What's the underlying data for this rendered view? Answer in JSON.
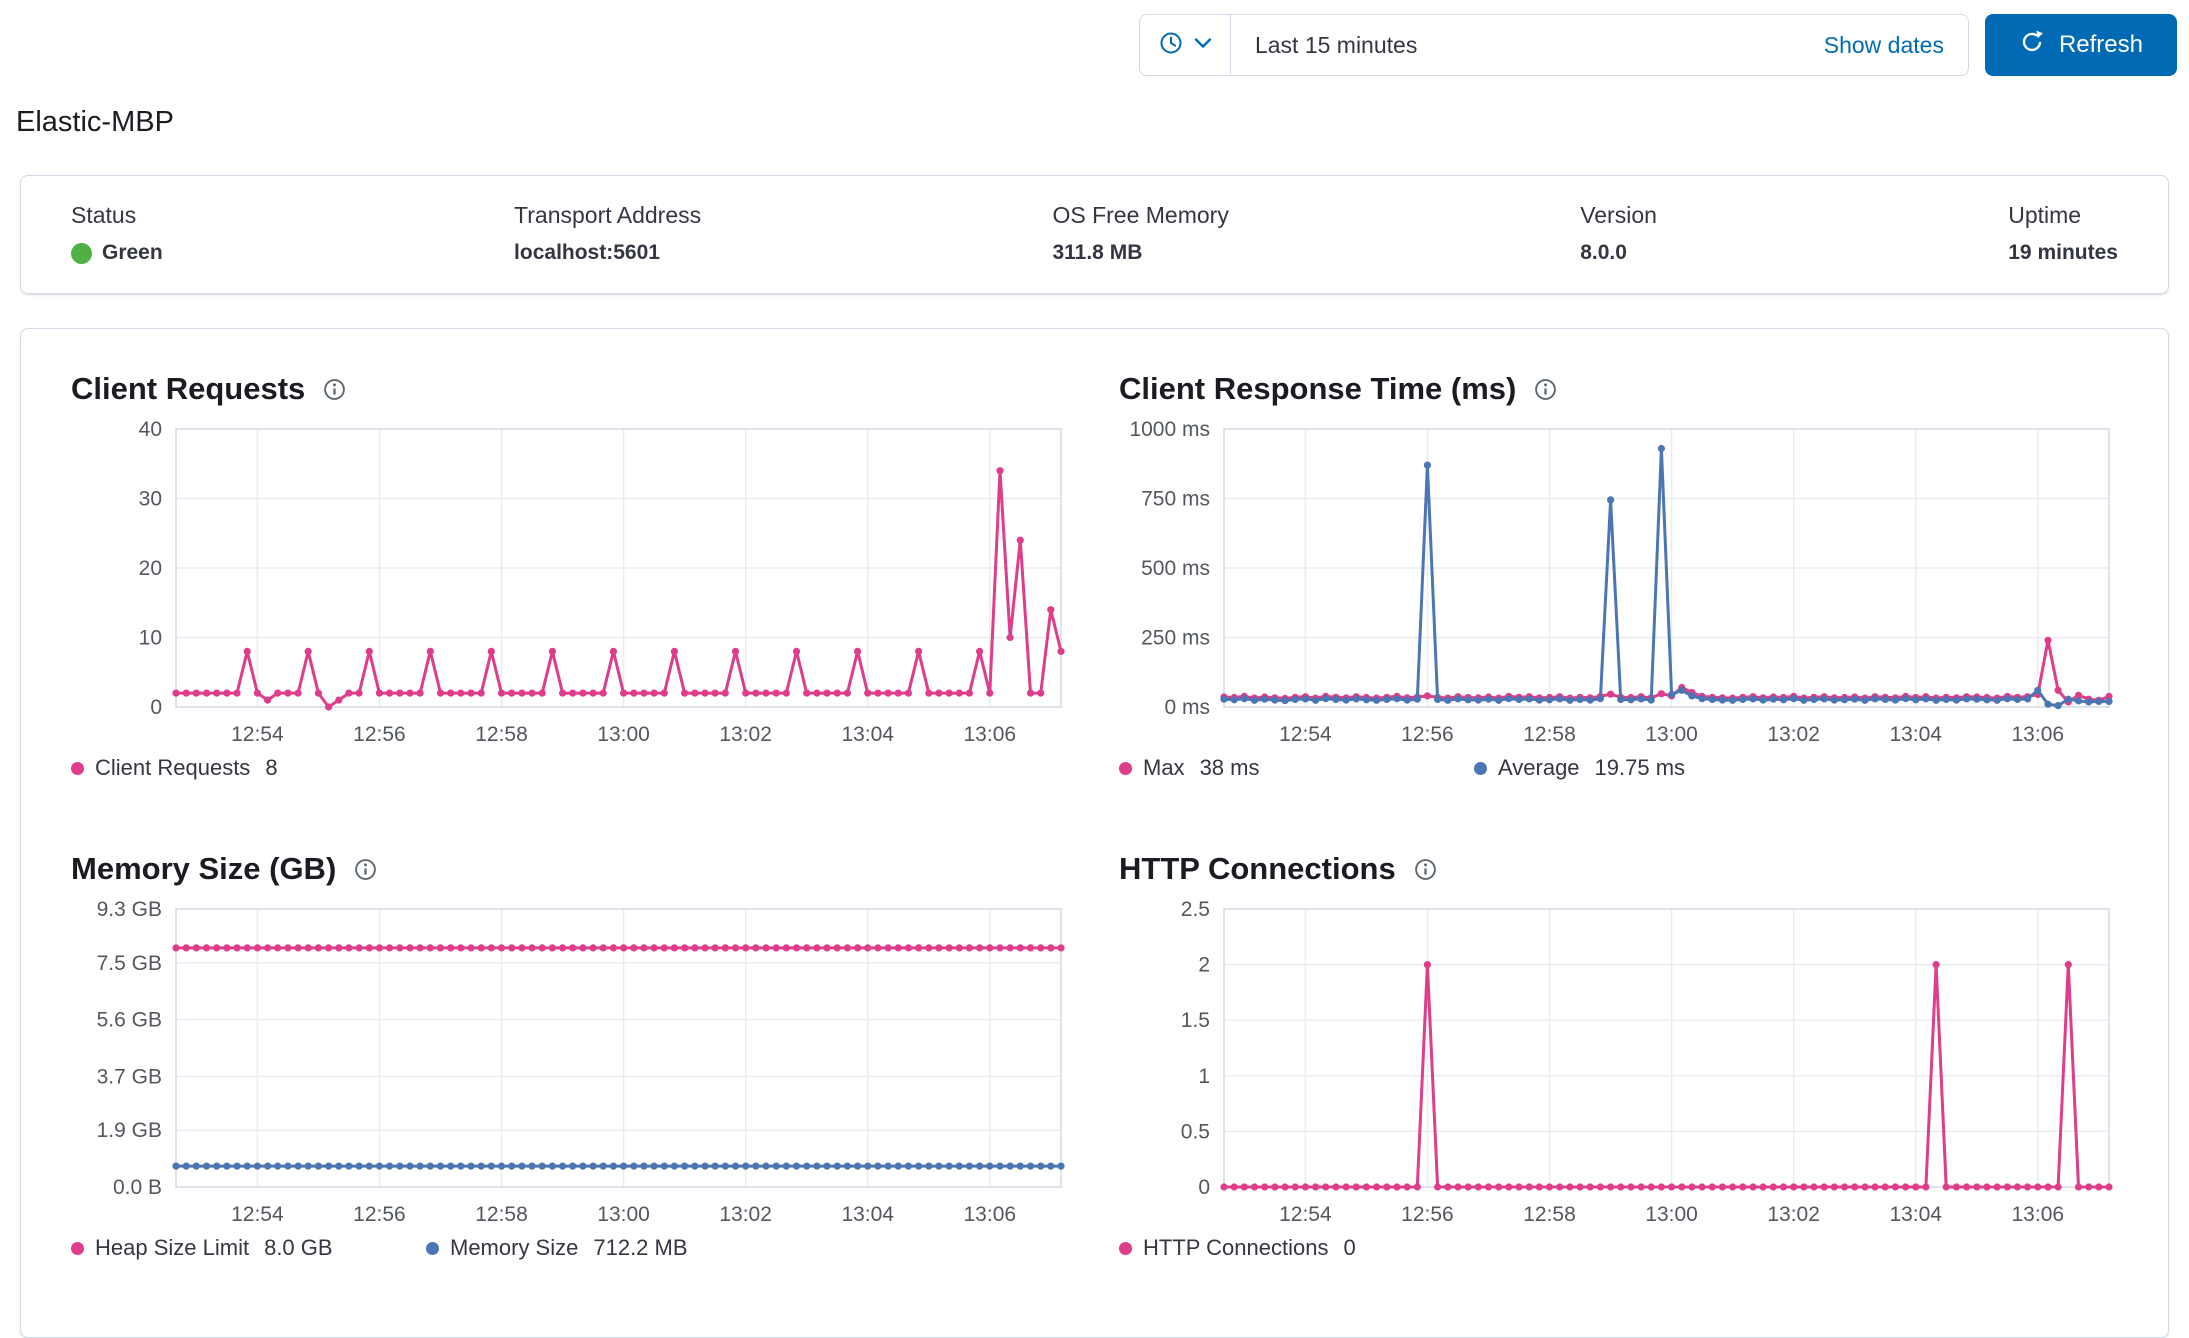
{
  "page": {
    "title": "Elastic-MBP"
  },
  "timepicker": {
    "quick_label": "Last 15 minutes",
    "show_dates": "Show dates",
    "refresh": "Refresh"
  },
  "colors": {
    "primary_blue": "#006bb4",
    "series_pink": "#dd3d8a",
    "series_blue": "#4c76b3",
    "status_green": "#4fb043",
    "grid_line": "#e9edf3",
    "plot_border": "#d3dae6"
  },
  "status_bar": {
    "items": [
      {
        "label": "Status",
        "value": "Green"
      },
      {
        "label": "Transport Address",
        "value": "localhost:5601"
      },
      {
        "label": "OS Free Memory",
        "value": "311.8 MB"
      },
      {
        "label": "Version",
        "value": "8.0.0"
      },
      {
        "label": "Uptime",
        "value": "19 minutes"
      }
    ]
  },
  "chart_data": [
    {
      "type": "line",
      "title": "Client Requests",
      "x_count": 88,
      "x_range": [
        0,
        87
      ],
      "x_tick_idx": [
        8,
        20,
        32,
        44,
        56,
        68,
        80
      ],
      "x_tick_labels": [
        "12:54",
        "12:56",
        "12:58",
        "13:00",
        "13:02",
        "13:04",
        "13:06"
      ],
      "y_range": [
        0,
        40
      ],
      "y_tick_values": [
        0,
        10,
        20,
        30,
        40
      ],
      "y_tick_labels": [
        "0",
        "10",
        "20",
        "30",
        "40"
      ],
      "grid": true,
      "legend_position": "bottom",
      "series": [
        {
          "name": "Client Requests",
          "legend_value": "8",
          "color": "#dd3d8a",
          "values": [
            2,
            2,
            2,
            2,
            2,
            2,
            2,
            8,
            2,
            1,
            2,
            2,
            2,
            8,
            2,
            0,
            1,
            2,
            2,
            8,
            2,
            2,
            2,
            2,
            2,
            8,
            2,
            2,
            2,
            2,
            2,
            8,
            2,
            2,
            2,
            2,
            2,
            8,
            2,
            2,
            2,
            2,
            2,
            8,
            2,
            2,
            2,
            2,
            2,
            8,
            2,
            2,
            2,
            2,
            2,
            8,
            2,
            2,
            2,
            2,
            2,
            8,
            2,
            2,
            2,
            2,
            2,
            8,
            2,
            2,
            2,
            2,
            2,
            8,
            2,
            2,
            2,
            2,
            2,
            8,
            2,
            34,
            10,
            24,
            2,
            2,
            14,
            8
          ]
        }
      ]
    },
    {
      "type": "line",
      "title": "Client Response Time (ms)",
      "x_count": 88,
      "x_range": [
        0,
        87
      ],
      "x_tick_idx": [
        8,
        20,
        32,
        44,
        56,
        68,
        80
      ],
      "x_tick_labels": [
        "12:54",
        "12:56",
        "12:58",
        "13:00",
        "13:02",
        "13:04",
        "13:06"
      ],
      "y_range": [
        0,
        1000
      ],
      "y_tick_values": [
        0,
        250,
        500,
        750,
        1000
      ],
      "y_tick_labels": [
        "0 ms",
        "250 ms",
        "500 ms",
        "750 ms",
        "1000 ms"
      ],
      "grid": true,
      "legend_position": "bottom",
      "series": [
        {
          "name": "Max",
          "legend_value": "38 ms",
          "color": "#dd3d8a",
          "values": [
            36,
            34,
            38,
            32,
            36,
            33,
            31,
            35,
            37,
            32,
            38,
            35,
            33,
            37,
            34,
            32,
            35,
            38,
            33,
            36,
            40,
            35,
            32,
            37,
            34,
            33,
            36,
            32,
            38,
            35,
            37,
            33,
            34,
            37,
            32,
            35,
            33,
            38,
            46,
            35,
            34,
            37,
            33,
            48,
            40,
            70,
            52,
            38,
            35,
            33,
            32,
            35,
            37,
            33,
            36,
            34,
            38,
            32,
            35,
            37,
            33,
            34,
            36,
            32,
            37,
            35,
            33,
            38,
            34,
            37,
            32,
            35,
            33,
            37,
            36,
            34,
            32,
            38,
            35,
            37,
            45,
            240,
            60,
            18,
            42,
            28,
            24,
            38
          ]
        },
        {
          "name": "Average",
          "legend_value": "19.75 ms",
          "color": "#4c76b3",
          "values": [
            28,
            26,
            30,
            24,
            28,
            25,
            23,
            27,
            29,
            24,
            30,
            27,
            25,
            29,
            26,
            24,
            27,
            30,
            25,
            28,
            870,
            27,
            24,
            29,
            26,
            25,
            28,
            24,
            30,
            27,
            29,
            25,
            26,
            29,
            24,
            27,
            25,
            30,
            745,
            27,
            26,
            29,
            25,
            930,
            45,
            60,
            40,
            30,
            27,
            25,
            24,
            27,
            29,
            25,
            28,
            26,
            30,
            24,
            27,
            29,
            25,
            26,
            28,
            24,
            29,
            27,
            25,
            30,
            26,
            29,
            24,
            27,
            25,
            29,
            28,
            26,
            24,
            30,
            27,
            29,
            60,
            10,
            5,
            28,
            22,
            18,
            20,
            20
          ]
        }
      ]
    },
    {
      "type": "line",
      "title": "Memory Size (GB)",
      "x_count": 88,
      "x_range": [
        0,
        87
      ],
      "x_tick_idx": [
        8,
        20,
        32,
        44,
        56,
        68,
        80
      ],
      "x_tick_labels": [
        "12:54",
        "12:56",
        "12:58",
        "13:00",
        "13:02",
        "13:04",
        "13:06"
      ],
      "y_range": [
        0,
        9.3
      ],
      "y_tick_values": [
        0,
        1.9,
        3.7,
        5.6,
        7.5,
        9.3
      ],
      "y_tick_labels": [
        "0.0 B",
        "1.9 GB",
        "3.7 GB",
        "5.6 GB",
        "7.5 GB",
        "9.3 GB"
      ],
      "grid": true,
      "legend_position": "bottom",
      "series": [
        {
          "name": "Heap Size Limit",
          "legend_value": "8.0 GB",
          "color": "#dd3d8a",
          "constant": 8.0
        },
        {
          "name": "Memory Size",
          "legend_value": "712.2 MB",
          "color": "#4c76b3",
          "constant": 0.7
        }
      ]
    },
    {
      "type": "line",
      "title": "HTTP Connections",
      "x_count": 88,
      "x_range": [
        0,
        87
      ],
      "x_tick_idx": [
        8,
        20,
        32,
        44,
        56,
        68,
        80
      ],
      "x_tick_labels": [
        "12:54",
        "12:56",
        "12:58",
        "13:00",
        "13:02",
        "13:04",
        "13:06"
      ],
      "y_range": [
        0,
        2.5
      ],
      "y_tick_values": [
        0,
        0.5,
        1,
        1.5,
        2,
        2.5
      ],
      "y_tick_labels": [
        "0",
        "0.5",
        "1",
        "1.5",
        "2",
        "2.5"
      ],
      "grid": true,
      "legend_position": "bottom",
      "series": [
        {
          "name": "HTTP Connections",
          "legend_value": "0",
          "color": "#dd3d8a",
          "values": [
            0,
            0,
            0,
            0,
            0,
            0,
            0,
            0,
            0,
            0,
            0,
            0,
            0,
            0,
            0,
            0,
            0,
            0,
            0,
            0,
            2,
            0,
            0,
            0,
            0,
            0,
            0,
            0,
            0,
            0,
            0,
            0,
            0,
            0,
            0,
            0,
            0,
            0,
            0,
            0,
            0,
            0,
            0,
            0,
            0,
            0,
            0,
            0,
            0,
            0,
            0,
            0,
            0,
            0,
            0,
            0,
            0,
            0,
            0,
            0,
            0,
            0,
            0,
            0,
            0,
            0,
            0,
            0,
            0,
            0,
            2,
            0,
            0,
            0,
            0,
            0,
            0,
            0,
            0,
            0,
            0,
            0,
            0,
            2,
            0,
            0,
            0,
            0
          ]
        }
      ]
    }
  ]
}
